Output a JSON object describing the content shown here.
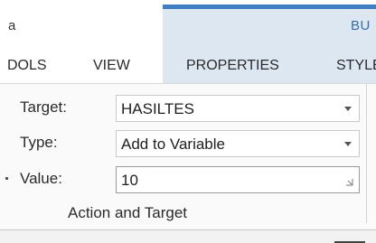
{
  "window": {
    "title_fragment": "a",
    "context_tab_label": "BU"
  },
  "tabs": [
    {
      "label": "DOLS"
    },
    {
      "label": "VIEW"
    },
    {
      "label": "PROPERTIES"
    },
    {
      "label": "STYLE"
    }
  ],
  "ribbon": {
    "group_label": "Action and Target",
    "target": {
      "label": "Target:",
      "value": "HASILTES"
    },
    "type": {
      "label": "Type:",
      "value": "Add to Variable"
    },
    "value": {
      "label": "Value:",
      "value": "10"
    }
  },
  "colors": {
    "context_band": "#dde7f2",
    "context_accent": "#3f7fc1",
    "context_text": "#3a6ea5",
    "ribbon_bg": "#fafafa"
  }
}
